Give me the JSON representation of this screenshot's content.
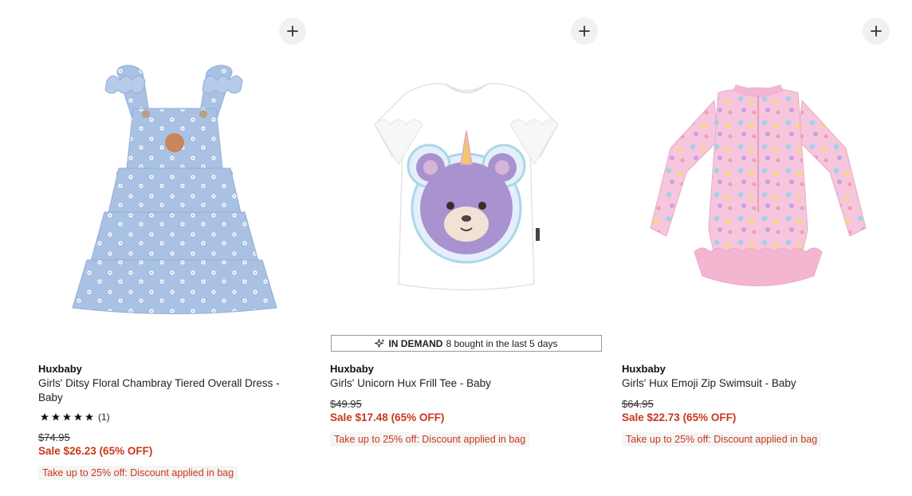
{
  "products": [
    {
      "brand": "Huxbaby",
      "title": "Girls' Ditsy Floral Chambray Tiered Overall Dress - Baby",
      "rating": {
        "stars": 5,
        "count_text": "(1)"
      },
      "original_price": "$74.95",
      "sale_price": "Sale $26.23 (65% OFF)",
      "promo": "Take up to 25% off: Discount applied in bag",
      "add_icon": "plus-icon"
    },
    {
      "brand": "Huxbaby",
      "title": "Girls' Unicorn Hux Frill Tee - Baby",
      "badge": {
        "strong": "IN DEMAND",
        "text": "8 bought in the last 5 days",
        "icon": "sparkle-icon"
      },
      "original_price": "$49.95",
      "sale_price": "Sale $17.48 (65% OFF)",
      "promo": "Take up to 25% off: Discount applied in bag",
      "add_icon": "plus-icon"
    },
    {
      "brand": "Huxbaby",
      "title": "Girls' Hux Emoji Zip Swimsuit - Baby",
      "original_price": "$64.95",
      "sale_price": "Sale $22.73 (65% OFF)",
      "promo": "Take up to 25% off: Discount applied in bag",
      "add_icon": "plus-icon"
    }
  ],
  "colors": {
    "sale": "#c8381b",
    "add_button_bg": "#f1f1f1",
    "promo_bg": "#f5f5f5"
  }
}
